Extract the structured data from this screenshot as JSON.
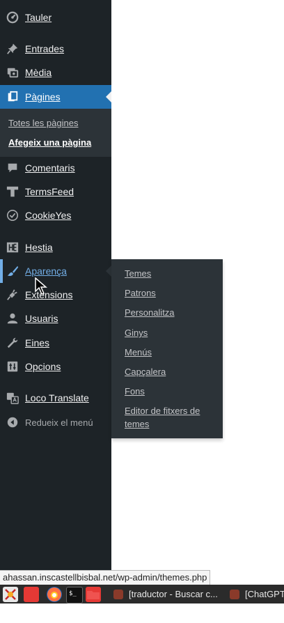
{
  "sidebar": {
    "items": [
      {
        "label": "Tauler",
        "icon": "dashboard-icon"
      },
      {
        "label": "Entrades",
        "icon": "pin-icon"
      },
      {
        "label": "Mèdia",
        "icon": "media-icon"
      },
      {
        "label": "Pàgines",
        "icon": "pages-icon",
        "current": true
      },
      {
        "label": "Comentaris",
        "icon": "comment-icon"
      },
      {
        "label": "TermsFeed",
        "icon": "termsfeed-icon"
      },
      {
        "label": "CookieYes",
        "icon": "cookieyes-icon"
      },
      {
        "label": "Hestia",
        "icon": "hestia-icon"
      },
      {
        "label": "Aparença",
        "icon": "brush-icon",
        "hovered": true
      },
      {
        "label": "Extensions",
        "icon": "plugin-icon"
      },
      {
        "label": "Usuaris",
        "icon": "user-icon"
      },
      {
        "label": "Eines",
        "icon": "wrench-icon"
      },
      {
        "label": "Opcions",
        "icon": "settings-icon"
      },
      {
        "label": "Loco Translate",
        "icon": "translate-icon"
      }
    ],
    "pages_submenu": [
      {
        "label": "Totes les pàgines"
      },
      {
        "label": "Afegeix una pàgina",
        "current": true
      }
    ],
    "collapse_label": "Redueix el menú"
  },
  "flyout": {
    "items": [
      "Temes",
      "Patrons",
      "Personalitza",
      "Ginys",
      "Menús",
      "Capçalera",
      "Fons",
      "Editor de fitxers de temes"
    ]
  },
  "status_bar": {
    "url": "ahassan.inscastellbisbal.net/wp-admin/themes.php"
  },
  "taskbar": {
    "windows": [
      {
        "label": "[traductor - Buscar c..."
      },
      {
        "label": "[ChatGPT"
      }
    ]
  },
  "colors": {
    "sidebar_bg": "#1d2327",
    "submenu_bg": "#2c3338",
    "accent": "#2271b1",
    "hover": "#72aee6"
  }
}
